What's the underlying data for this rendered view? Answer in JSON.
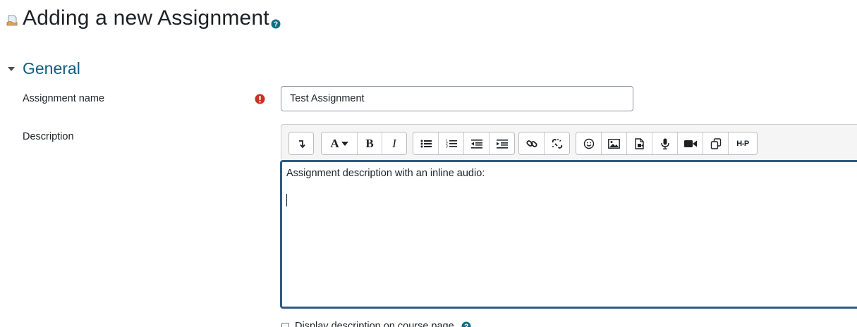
{
  "header": {
    "title": "Adding a new Assignment",
    "module_icon": "assignment-icon",
    "help_icon": "help-icon"
  },
  "section": {
    "title": "General",
    "toggle_icon": "caret-down-icon"
  },
  "form": {
    "assignment_name_label": "Assignment name",
    "assignment_name_value": "Test Assignment",
    "required_icon": "required-icon",
    "description_label": "Description",
    "description_text": "Assignment description with an inline audio:",
    "display_description_label": "Display description on course page",
    "display_description_checked": false
  },
  "editor_toolbar": {
    "groups": [
      [
        "collapse"
      ],
      [
        "style",
        "bold",
        "italic"
      ],
      [
        "unordered-list",
        "ordered-list",
        "outdent",
        "indent"
      ],
      [
        "link",
        "unlink"
      ],
      [
        "emoji",
        "image",
        "media",
        "record-audio",
        "record-video",
        "manage-files",
        "h5p"
      ]
    ],
    "style_glyph": "A",
    "bold_glyph": "B",
    "italic_glyph": "I",
    "h5p_glyph": "H-P"
  },
  "colors": {
    "section_title": "#115e80",
    "required": "#ca3120",
    "editor_focus_border": "#2f5a86",
    "help": "#0f6e84"
  }
}
